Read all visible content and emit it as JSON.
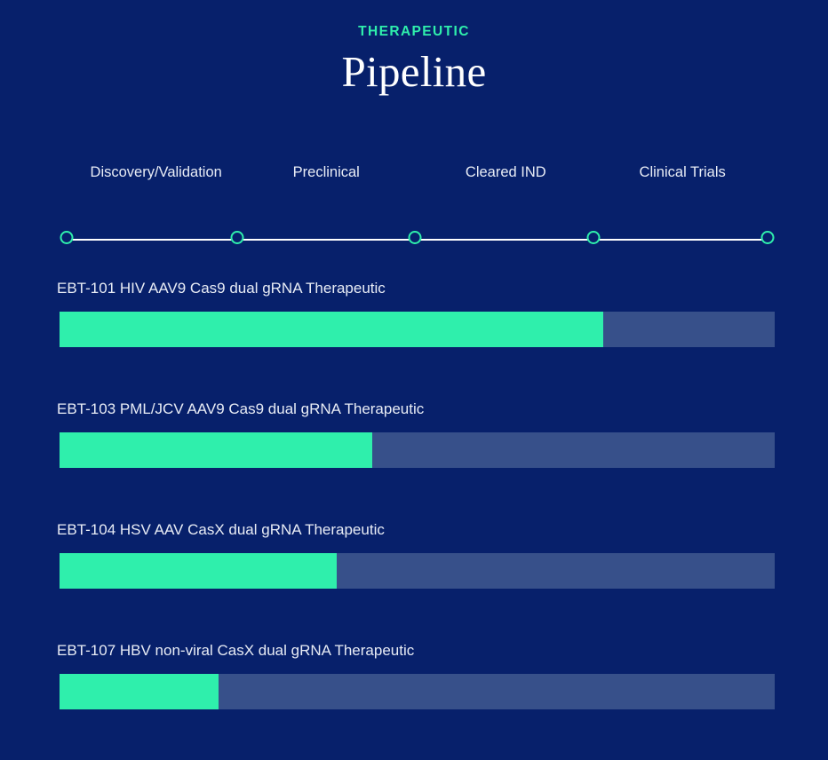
{
  "header": {
    "eyebrow": "THERAPEUTIC",
    "title": "Pipeline"
  },
  "colors": {
    "background": "#07206b",
    "accent_green": "#2fefac",
    "track_blue": "#37508a",
    "text_light": "#e8ecf5",
    "line_white": "#ffffff"
  },
  "stages": [
    {
      "label": "Discovery/Validation",
      "center_pct": 13.5
    },
    {
      "label": "Preclinical",
      "center_pct": 37.3
    },
    {
      "label": "Cleared IND",
      "center_pct": 62.4
    },
    {
      "label": "Clinical Trials",
      "center_pct": 87.1
    }
  ],
  "milestones": [
    {
      "name": "milestone-1",
      "pos_pct": 1.0
    },
    {
      "name": "milestone-2",
      "pos_pct": 24.9
    },
    {
      "name": "milestone-3",
      "pos_pct": 49.7
    },
    {
      "name": "milestone-4",
      "pos_pct": 74.6
    },
    {
      "name": "milestone-5",
      "pos_pct": 99.0
    }
  ],
  "programs": [
    {
      "name": "EBT-101 HIV AAV9 Cas9 dual gRNA Therapeutic",
      "progress_pct": 76
    },
    {
      "name": "EBT-103 PML/JCV AAV9 Cas9 dual gRNA Therapeutic",
      "progress_pct": 43.7
    },
    {
      "name": "EBT-104 HSV AAV CasX dual gRNA Therapeutic",
      "progress_pct": 38.8
    },
    {
      "name": "EBT-107 HBV non-viral CasX dual gRNA Therapeutic",
      "progress_pct": 22.2
    }
  ]
}
